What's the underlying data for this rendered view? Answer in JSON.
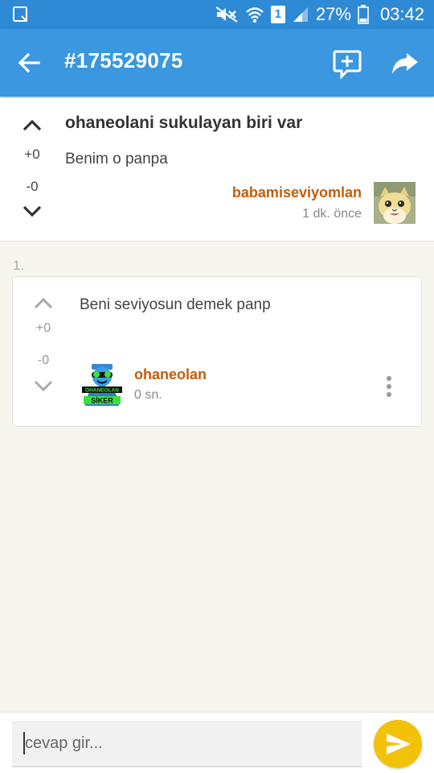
{
  "status_bar": {
    "battery_percent": "27%",
    "time": "03:42",
    "sim_slot": "1"
  },
  "app_bar": {
    "title": "#175529075",
    "icons": [
      "back-arrow-icon",
      "add-comment-icon",
      "share-icon"
    ]
  },
  "post": {
    "title": "ohaneolani sukulayan biri var",
    "body": "Benim o panpa",
    "upvotes": "+0",
    "downvotes": "-0",
    "author": "babamiseviyomlan",
    "time": "1 dk. önce"
  },
  "comments": [
    {
      "index": "1.",
      "text": "Beni seviyosun demek panp",
      "upvotes": "+0",
      "downvotes": "-0",
      "author": "ohaneolan",
      "time": "0 sn.",
      "avatar_text": [
        "OHANEOLAN",
        "SİKER"
      ]
    }
  ],
  "reply_bar": {
    "placeholder": "cevap gir..."
  },
  "colors": {
    "app_bar": "#3a97e0",
    "status_bar": "#2f8ad6",
    "author": "#c45c0a",
    "send_button": "#f2c20a",
    "background": "#f7f6ee"
  }
}
